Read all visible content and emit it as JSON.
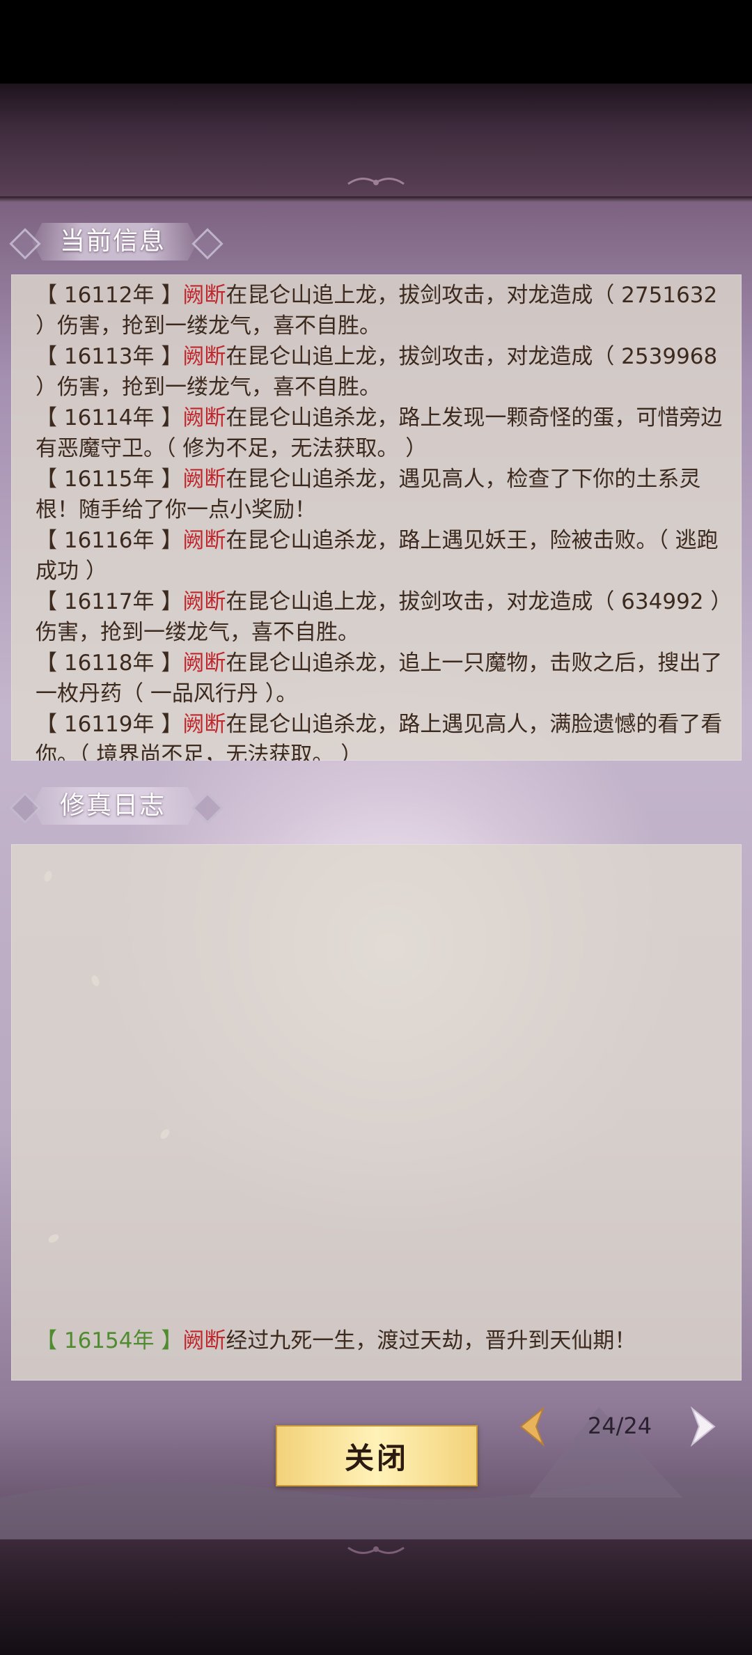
{
  "colors": {
    "name_red": "#c0272d",
    "year_green": "#4f8b2f",
    "text_brown": "#3d2a1f",
    "button_gold": "#f3d27a"
  },
  "sections": {
    "current_title": "当前信息",
    "log_title": "修真日志"
  },
  "current_info": [
    {
      "year": "【 16112年 】",
      "name": "阙断",
      "text": "在昆仑山追上龙，拔剑攻击，对龙造成（ 2751632 ）伤害，抢到一缕龙气，喜不自胜。"
    },
    {
      "year": "【 16113年 】",
      "name": "阙断",
      "text": "在昆仑山追上龙，拔剑攻击，对龙造成（ 2539968 ）伤害，抢到一缕龙气，喜不自胜。"
    },
    {
      "year": "【 16114年 】",
      "name": "阙断",
      "text": "在昆仑山追杀龙，路上发现一颗奇怪的蛋，可惜旁边有恶魔守卫。（ 修为不足，无法获取。 ）"
    },
    {
      "year": "【 16115年 】",
      "name": "阙断",
      "text": "在昆仑山追杀龙，遇见高人，检查了下你的土系灵根！随手给了你一点小奖励！"
    },
    {
      "year": "【 16116年 】",
      "name": "阙断",
      "text": "在昆仑山追杀龙，路上遇见妖王，险被击败。（ 逃跑成功 ）"
    },
    {
      "year": "【 16117年 】",
      "name": "阙断",
      "text": "在昆仑山追上龙，拔剑攻击，对龙造成（ 634992 ）伤害，抢到一缕龙气，喜不自胜。"
    },
    {
      "year": "【 16118年 】",
      "name": "阙断",
      "text": "在昆仑山追杀龙，追上一只魔物，击败之后，搜出了一枚丹药（ 一品风行丹 ）。"
    },
    {
      "year": "【 16119年 】",
      "name": "阙断",
      "text": "在昆仑山追杀龙，路上遇见高人，满脸遗憾的看了看你。（ 境界尚不足，无法获取。 ）"
    }
  ],
  "cultivation_log": [
    {
      "year": "【 16154年 】",
      "name": "阙断",
      "text": "经过九死一生，渡过天劫，晋升到天仙期！"
    }
  ],
  "controls": {
    "close_label": "关闭",
    "pager": "24/24",
    "prev_icon": "chevron-left-icon",
    "next_icon": "chevron-right-icon"
  }
}
